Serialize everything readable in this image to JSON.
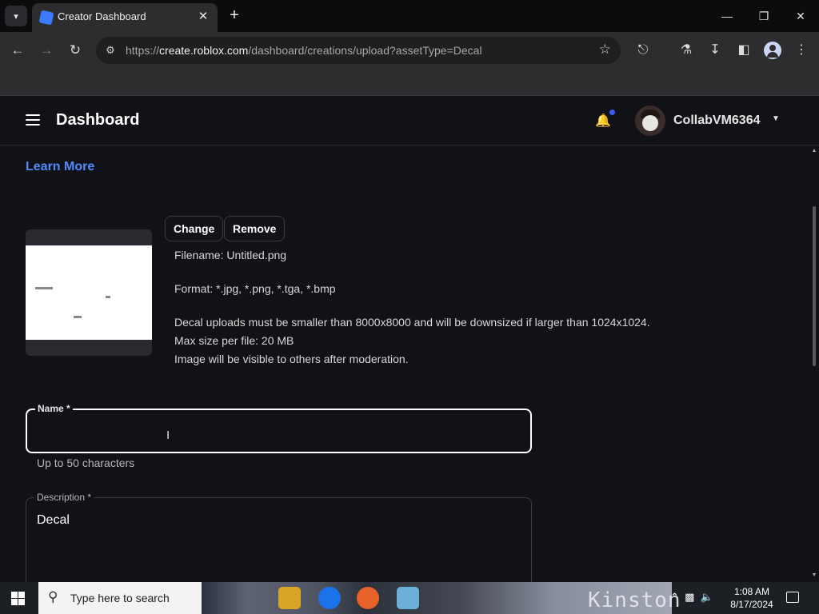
{
  "browser": {
    "tab_title": "Creator Dashboard",
    "url_scheme": "https://",
    "url_host": "create.roblox.com",
    "url_path": "/dashboard/creations/upload?assetType=Decal"
  },
  "header": {
    "title": "Dashboard",
    "username": "CollabVM6364",
    "notification_dot_color": "#3b5bff"
  },
  "page": {
    "learn_more": "Learn More",
    "change_label": "Change",
    "remove_label": "Remove",
    "filename": "Filename: Untitled.png",
    "format": "Format: *.jpg, *.png, *.tga, *.bmp",
    "size_note": "Decal uploads must be smaller than 8000x8000 and will be downsized if larger than 1024x1024.",
    "max_size": "Max size per file: 20 MB",
    "visibility_note": "Image will be visible to others after moderation."
  },
  "form": {
    "name_label": "Name *",
    "name_value": "",
    "name_helper": "Up to 50 characters",
    "description_label": "Description *",
    "description_value": "Decal"
  },
  "taskbar": {
    "search_placeholder": "Type here to search",
    "time": "1:08 AM",
    "date": "8/17/2024",
    "wallpaper_text": "Kinston"
  },
  "colors": {
    "accent_link": "#4f8bff",
    "page_bg": "#111216"
  }
}
